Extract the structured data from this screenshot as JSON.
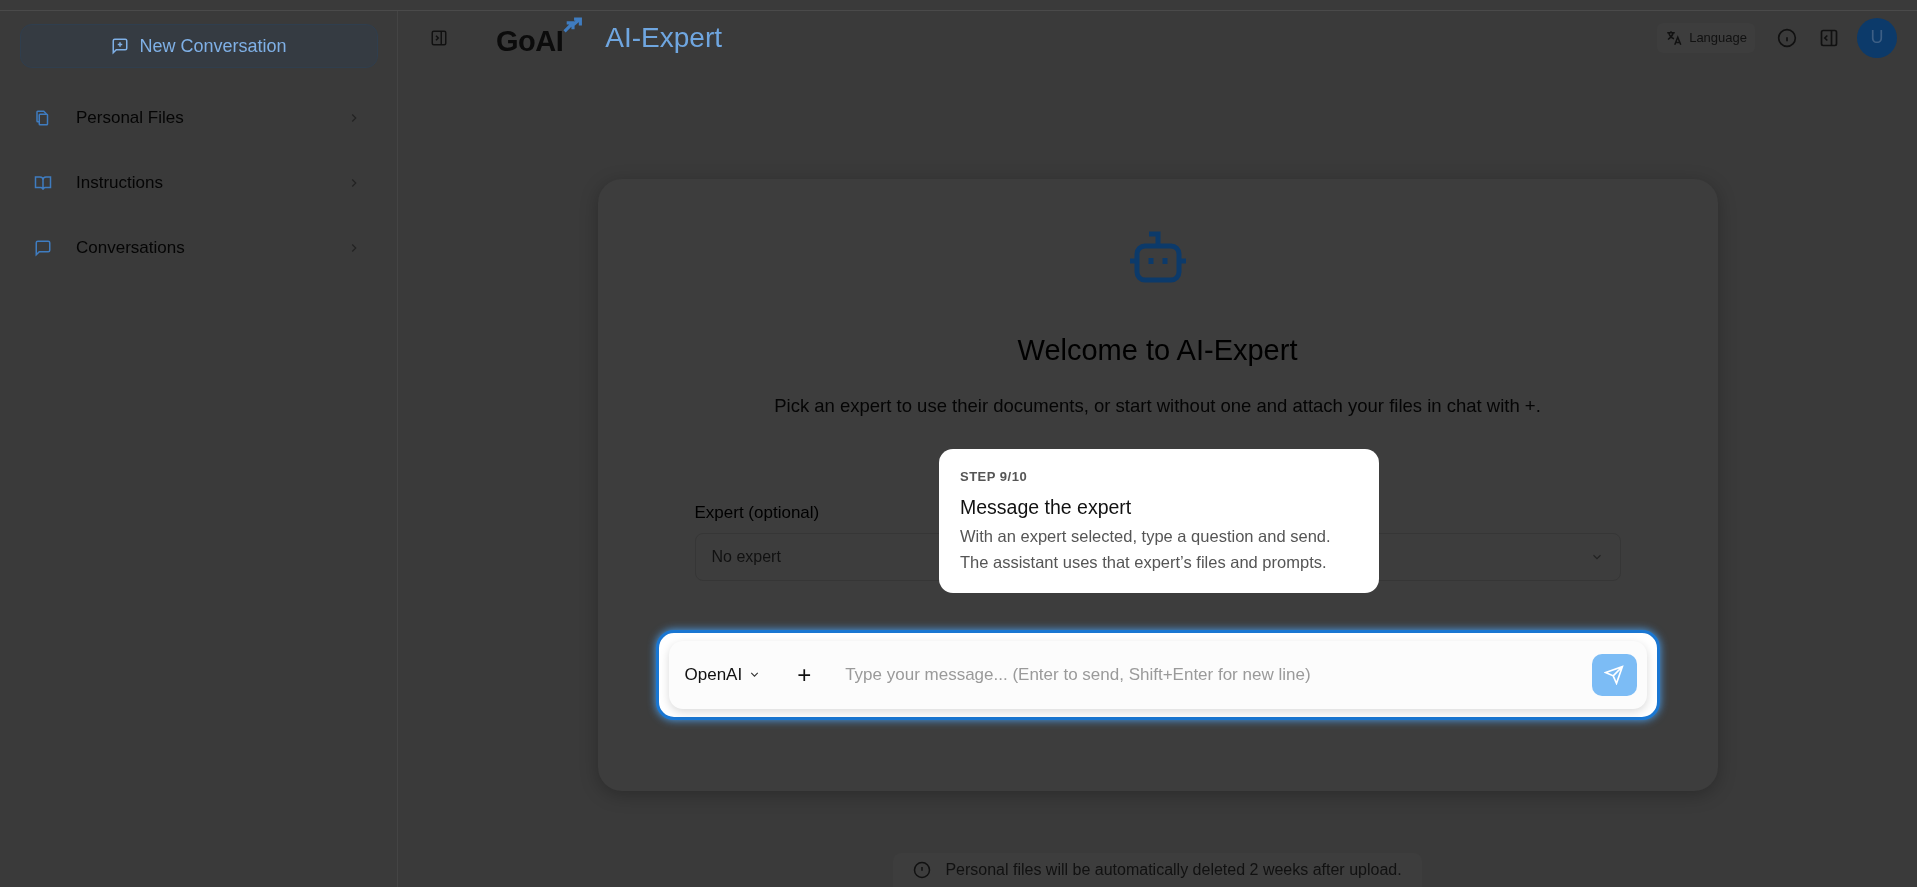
{
  "sidebar": {
    "new_button": "New Conversation",
    "items": [
      {
        "label": "Personal Files",
        "expanded": false
      },
      {
        "label": "Instructions",
        "expanded": false
      },
      {
        "label": "Conversations",
        "expanded": false
      }
    ]
  },
  "header": {
    "logo": "GoAI",
    "title": "AI-Expert",
    "language_button": "Language",
    "avatar": "U"
  },
  "welcome": {
    "title": "Welcome to AI-Expert",
    "subtitle": "Pick an expert to use their documents, or start without one and attach your files in chat with +.",
    "expert_label": "Expert (optional)",
    "expert_value": "No expert"
  },
  "tour": {
    "step": "STEP 9/10",
    "title": "Message the expert",
    "body": "With an expert selected, type a question and send. The assistant uses that expert’s files and prompts."
  },
  "chat": {
    "model": "OpenAI",
    "attach": "+",
    "placeholder": "Type your message... (Enter to send, Shift+Enter for new line)"
  },
  "notice": "Personal files will be automatically deleted 2 weeks after upload."
}
